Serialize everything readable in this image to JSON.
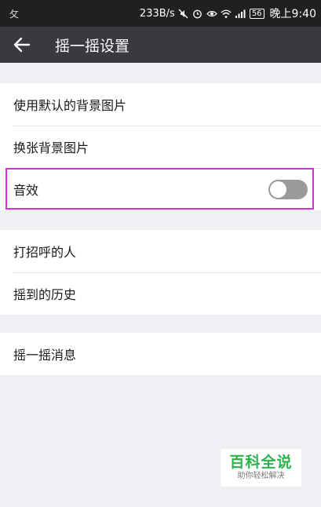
{
  "status_bar": {
    "left_glyph": "攵",
    "net_speed": "233B/s",
    "battery": "56",
    "time": "晚上9:40"
  },
  "toolbar": {
    "back_icon": "arrow-left-icon",
    "title": "摇一摇设置"
  },
  "groups": {
    "group1": [
      {
        "label": "使用默认的背景图片"
      },
      {
        "label": "换张背景图片"
      },
      {
        "label": "音效",
        "toggle": {
          "on": false
        }
      }
    ],
    "group2": [
      {
        "label": "打招呼的人"
      },
      {
        "label": "摇到的历史"
      }
    ],
    "group3": [
      {
        "label": "摇一摇消息"
      }
    ]
  },
  "watermark": {
    "title": "百科全说",
    "subtitle": "助你轻松解决"
  },
  "colors": {
    "toolbar_bg": "#393a3f",
    "highlight": "#e028e0",
    "toggle_off": "#9a9a9a",
    "watermark_green": "#2bb24c"
  }
}
